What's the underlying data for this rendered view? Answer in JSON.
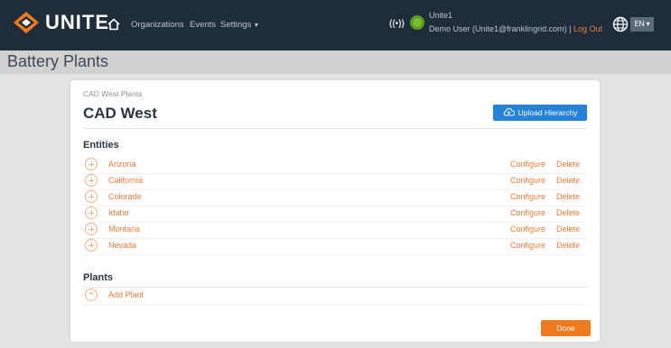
{
  "header": {
    "brand": "UNITE",
    "nav": [
      {
        "label": "Organizations"
      },
      {
        "label": "Events"
      },
      {
        "label": "Settings"
      }
    ],
    "user": {
      "name": "Unite1",
      "line": "Demo User (Unite1@franklingrid.com) |",
      "logout": "Log Out"
    },
    "language": "EN"
  },
  "page": {
    "title": "Battery Plants"
  },
  "card": {
    "breadcrumb": "CAD West Plants",
    "title": "CAD West",
    "upload_label": "Upload Hierarchy",
    "entities_title": "Entities",
    "entities": [
      {
        "label": "Arizona",
        "configure": "Configure",
        "delete": "Delete"
      },
      {
        "label": "California",
        "configure": "Configure",
        "delete": "Delete"
      },
      {
        "label": "Colorado",
        "configure": "Configure",
        "delete": "Delete"
      },
      {
        "label": "Idaho",
        "configure": "Configure",
        "delete": "Delete"
      },
      {
        "label": "Montana",
        "configure": "Configure",
        "delete": "Delete"
      },
      {
        "label": "Nevada",
        "configure": "Configure",
        "delete": "Delete"
      }
    ],
    "plants_title": "Plants",
    "add_plant_label": "Add Plant",
    "done_label": "Done"
  },
  "colors": {
    "topbar": "#1f2d3b",
    "accent_orange": "#f07a3a",
    "upload_blue": "#2582d8",
    "done_orange": "#f07a1e"
  }
}
